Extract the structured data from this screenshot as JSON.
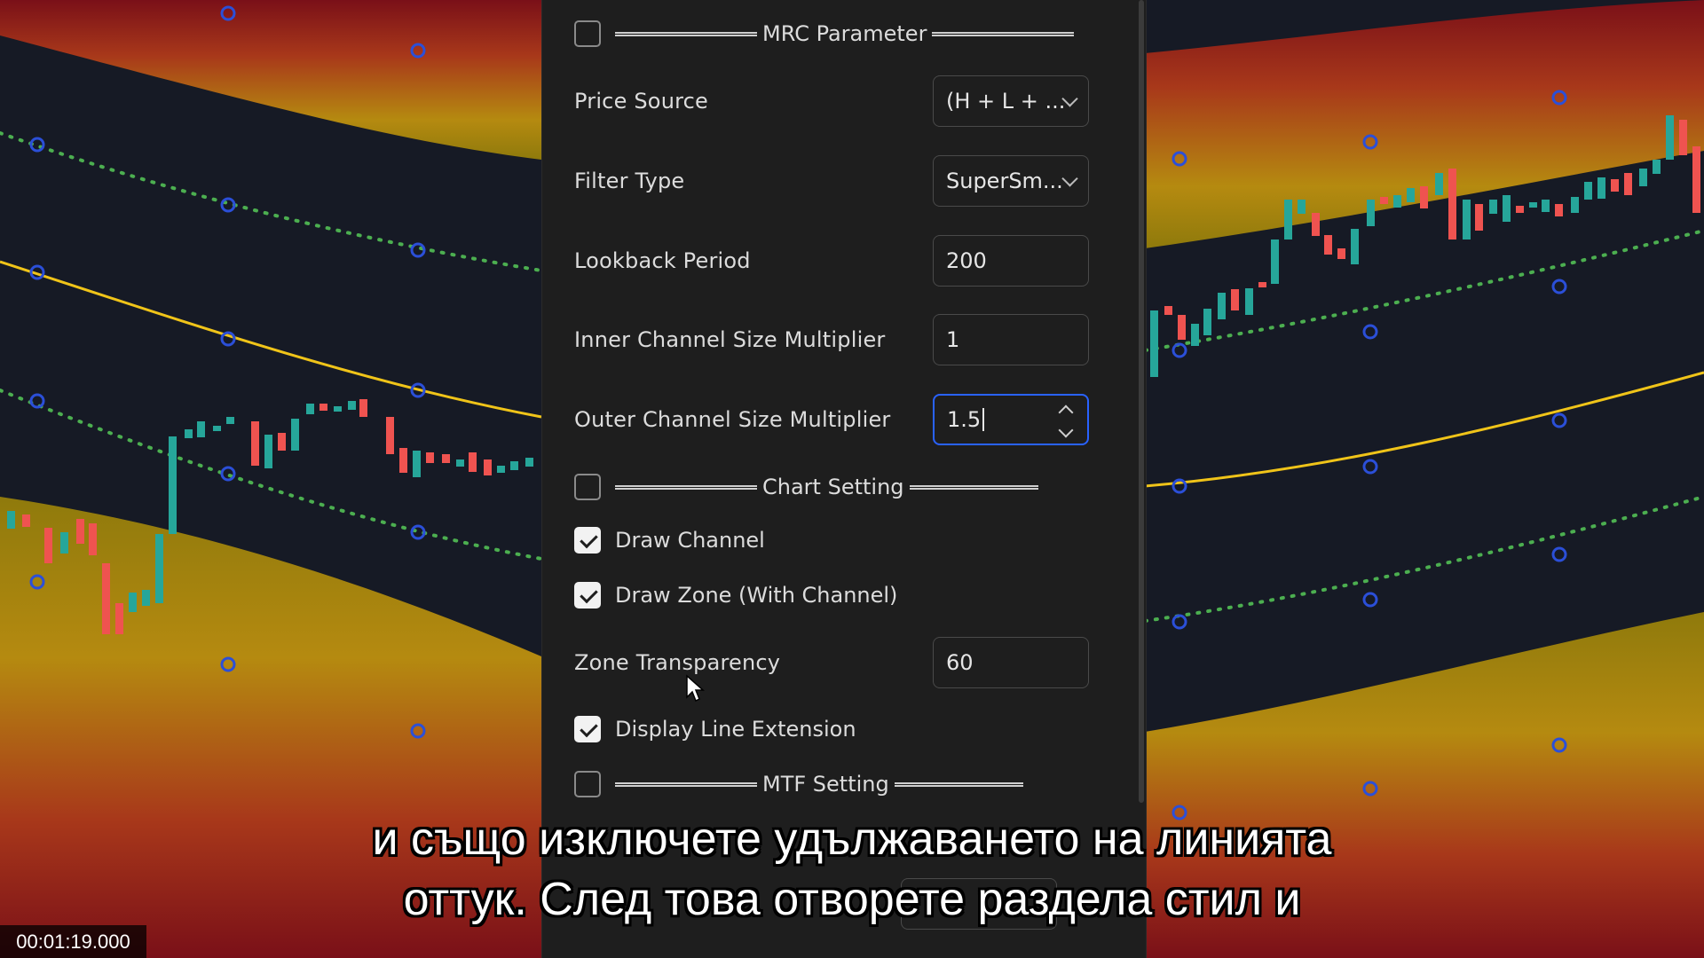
{
  "sections": {
    "mrc": {
      "title": "MRC Parameter",
      "checked": false
    },
    "chart": {
      "title": "Chart Setting",
      "checked": false
    },
    "mtf": {
      "title": "MTF Setting",
      "checked": false
    }
  },
  "fields": {
    "price_source": {
      "label": "Price Source",
      "value": "(H + L + ..."
    },
    "filter_type": {
      "label": "Filter Type",
      "value": "SuperSm..."
    },
    "lookback_period": {
      "label": "Lookback Period",
      "value": "200"
    },
    "inner_multiplier": {
      "label": "Inner Channel Size Multiplier",
      "value": "1"
    },
    "outer_multiplier": {
      "label": "Outer Channel Size Multiplier",
      "value": "1.5"
    },
    "zone_transparency": {
      "label": "Zone Transparency",
      "value": "60"
    }
  },
  "checkboxes": {
    "draw_channel": {
      "label": "Draw Channel",
      "checked": true
    },
    "draw_zone": {
      "label": "Draw Zone (With Channel)",
      "checked": true
    },
    "display_line_extension": {
      "label": "Display Line Extension",
      "checked": true
    }
  },
  "subtitles": {
    "line1": "и също изключете удължаването на линията",
    "line2": "оттук. След това отворете раздела стил и"
  },
  "timestamp": "00:01:19.000",
  "colors": {
    "background": "#161a25",
    "panel": "#1e1e1e",
    "accent": "#2962ff",
    "band_yellow": "#c8a000",
    "band_red": "#a01020",
    "midline": "#f0c419",
    "dots_green": "#4caf50",
    "handle_blue": "#2b4fd8",
    "candle_up": "#26a69a",
    "candle_down": "#ef5350"
  }
}
